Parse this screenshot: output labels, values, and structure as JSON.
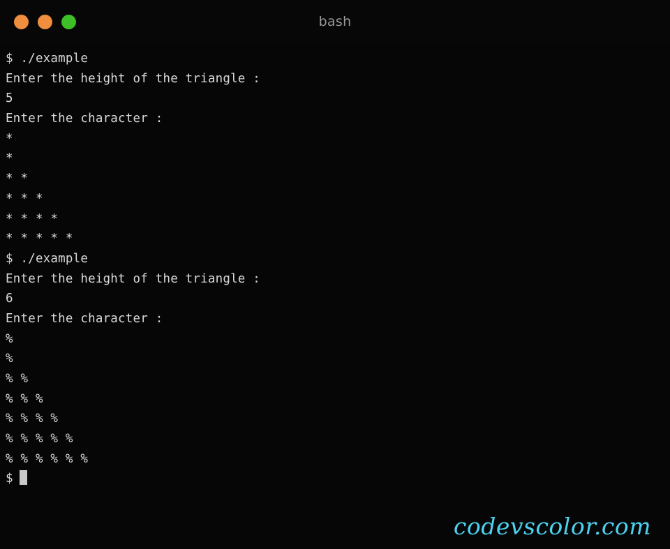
{
  "window": {
    "title": "bash",
    "background_color": "#060606",
    "titlebar_color": "#070707",
    "text_color": "#d9d9d9"
  },
  "controls": [
    {
      "name": "close",
      "color": "#ef8e3f"
    },
    {
      "name": "minimize",
      "color": "#ef8e3f"
    },
    {
      "name": "maximize",
      "color": "#3ebf27"
    }
  ],
  "terminal": {
    "prompt_symbol": "$",
    "cursor_color": "#c9c9c9",
    "lines": [
      "$ ./example",
      "Enter the height of the triangle :",
      "5",
      "Enter the character :",
      "*",
      "*",
      "* *",
      "* * *",
      "* * * *",
      "* * * * *",
      "$ ./example",
      "Enter the height of the triangle :",
      "6",
      "Enter the character :",
      "%",
      "%",
      "% %",
      "% % %",
      "% % % %",
      "% % % % %",
      "% % % % % %"
    ],
    "final_prompt": "$"
  },
  "watermark": {
    "text": "codevscolor.com",
    "color": "#4dd2f0"
  }
}
